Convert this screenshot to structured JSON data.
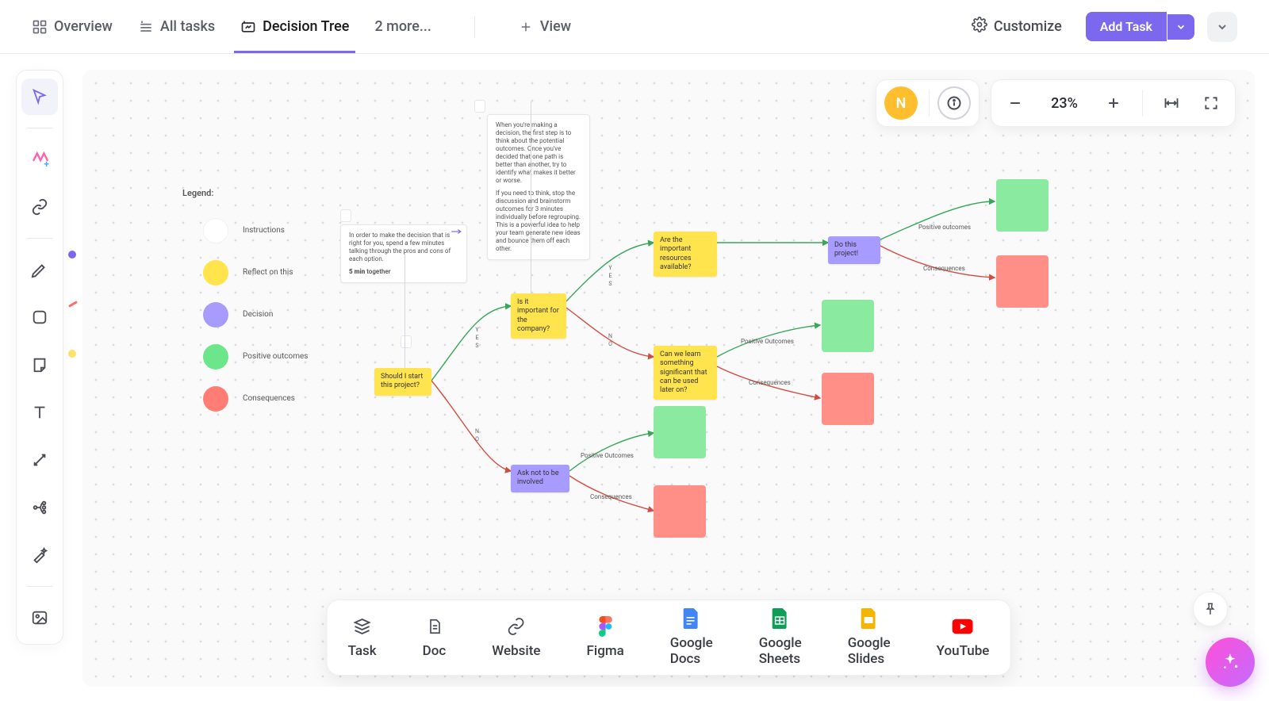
{
  "tabs": {
    "overview": "Overview",
    "alltasks": "All tasks",
    "decisiontree": "Decision Tree",
    "more": "2 more...",
    "view": "View"
  },
  "actions": {
    "customize": "Customize",
    "addtask": "Add Task"
  },
  "user": {
    "initial": "N"
  },
  "zoom": {
    "level": "23%"
  },
  "legend": {
    "title": "Legend:",
    "instructions": "Instructions",
    "reflect": "Reflect on this",
    "decision": "Decision",
    "positive": "Positive outcomes",
    "consequences": "Consequences",
    "colors": {
      "instructions": "#ffffff",
      "reflect": "#ffe44d",
      "decision": "#a89bff",
      "positive": "#6be68a",
      "consequences": "#ff7d74"
    }
  },
  "notes": {
    "instr1": "In order to make the decision that is right for you, spend a few minutes talking through the pros and cons of each option.",
    "instr1_b": "5 min together",
    "instr2": "When you're making a decision, the first step is to think about the potential outcomes. Once you've decided that one path is better than another, try to identify what makes it better or worse.",
    "instr2b": "If you need to think, stop the discussion and brainstorm outcomes for 3 minutes individually before regrouping. This is a powerful idea to help your team generate new ideas and bounce them off each other.",
    "n1": "Should I start this project?",
    "n2": "Is it important for the company?",
    "n3": "Ask not to be involved",
    "n4": "Are the important resources available?",
    "n5": "Can we learn something significant that can be used later on?",
    "n6": "Do this project!",
    "pos": "Positive Outcomes",
    "pos_lc": "Positive outcomes",
    "cons": "Consequences"
  },
  "yn": {
    "yes": "Y\nE\nS",
    "no": "N\nO"
  },
  "dock": {
    "task": "Task",
    "doc": "Doc",
    "website": "Website",
    "figma": "Figma",
    "gdocs": "Google Docs",
    "gsheets": "Google Sheets",
    "gslides": "Google Slides",
    "youtube": "YouTube"
  }
}
